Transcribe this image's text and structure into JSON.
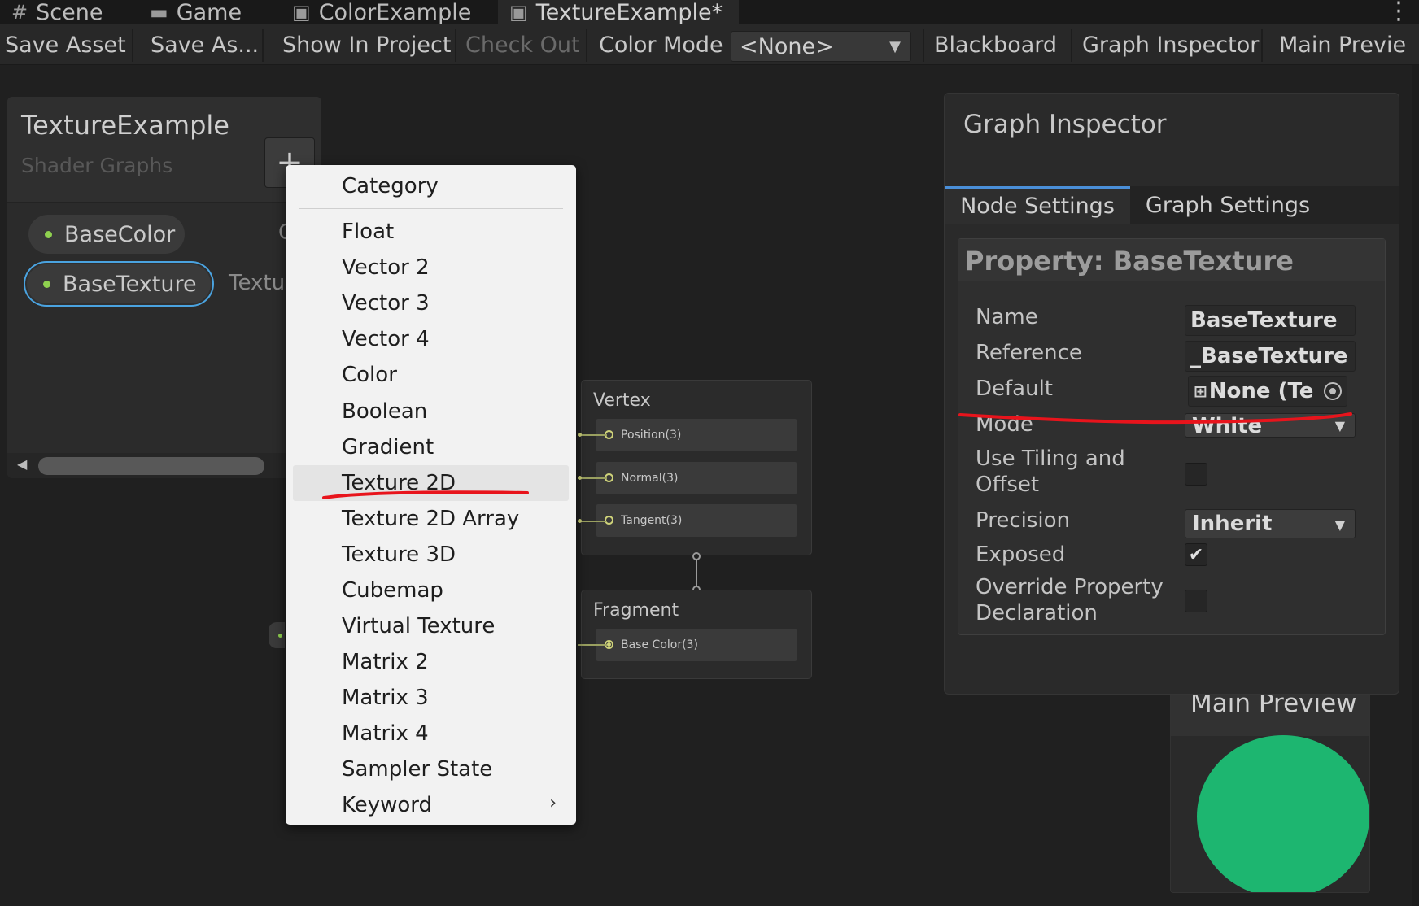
{
  "tabs": [
    {
      "label": "Scene",
      "icon": "grid-icon"
    },
    {
      "label": "Game",
      "icon": "gamepad-icon"
    },
    {
      "label": "ColorExample",
      "icon": "shadergraph-icon"
    },
    {
      "label": "TextureExample*",
      "icon": "shadergraph-icon"
    }
  ],
  "toolbar": {
    "save_asset": "Save Asset",
    "save_as": "Save As...",
    "show_in_project": "Show In Project",
    "check_out": "Check Out",
    "color_mode_label": "Color Mode",
    "color_mode_value": "<None>",
    "blackboard": "Blackboard",
    "graph_inspector": "Graph Inspector",
    "main_preview": "Main Previe"
  },
  "blackboard": {
    "title": "TextureExample",
    "subtitle": "Shader Graphs",
    "add_button": "+",
    "properties": [
      {
        "name": "BaseColor",
        "type": "C"
      },
      {
        "name": "BaseTexture",
        "type": "Textu"
      }
    ]
  },
  "dropdown": {
    "header": "Category",
    "items": [
      "Float",
      "Vector 2",
      "Vector 3",
      "Vector 4",
      "Color",
      "Boolean",
      "Gradient",
      "Texture 2D",
      "Texture 2D Array",
      "Texture 3D",
      "Cubemap",
      "Virtual Texture",
      "Matrix 2",
      "Matrix 3",
      "Matrix 4",
      "Sampler State",
      "Keyword"
    ],
    "highlighted": "Texture 2D",
    "submenu_arrow": "›"
  },
  "master_stack": {
    "vertex_title": "Vertex",
    "vertex_slots": [
      "Position(3)",
      "Normal(3)",
      "Tangent(3)"
    ],
    "fragment_title": "Fragment",
    "fragment_slots": [
      "Base Color(3)"
    ]
  },
  "inspector": {
    "title": "Graph Inspector",
    "tabs": [
      "Node Settings",
      "Graph Settings"
    ],
    "active_tab": "Node Settings",
    "property_header": "Property: BaseTexture",
    "rows": {
      "name_label": "Name",
      "name_value": "BaseTexture",
      "reference_label": "Reference",
      "reference_value": "_BaseTexture",
      "default_label": "Default",
      "default_value": "None (Te",
      "mode_label": "Mode",
      "mode_value": "White",
      "tiling_label": "Use Tiling and\nOffset",
      "tiling_checked": false,
      "precision_label": "Precision",
      "precision_value": "Inherit",
      "exposed_label": "Exposed",
      "exposed_checked": true,
      "override_label": "Override Property\nDeclaration",
      "override_checked": false
    }
  },
  "main_preview": {
    "title": "Main Preview",
    "sphere_color": "#1db670"
  },
  "colors": {
    "accent_blue": "#4a8fd8",
    "property_dot": "#8fd14f",
    "annotation_red": "#e8141c"
  }
}
